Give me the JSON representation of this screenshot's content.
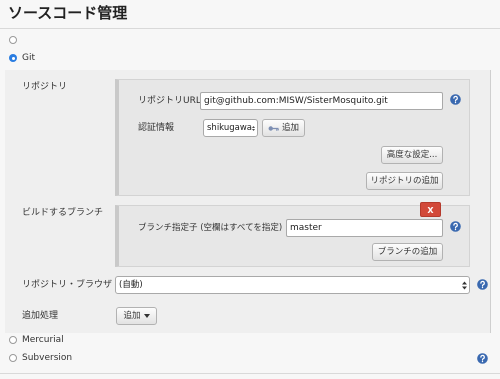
{
  "section_title": "ソースコード管理",
  "scm_options": {
    "git_label": "Git",
    "git_selected": true,
    "mercurial_label": "Mercurial",
    "subversion_label": "Subversion"
  },
  "git": {
    "repositories_label": "リポジトリ",
    "repository": {
      "url_label": "リポジトリURL",
      "url_value": "git@github.com:MISW/SisterMosquito.git",
      "credentials_label": "認証情報",
      "credentials_selected": "shikugawa",
      "add_credentials_label": "追加",
      "advanced_label": "高度な設定...",
      "add_repository_label": "リポジトリの追加"
    },
    "branches_label": "ビルドするブランチ",
    "branch": {
      "delete_label": "X",
      "specifier_label": "ブランチ指定子 (空欄はすべてを指定)",
      "specifier_value": "master",
      "add_branch_label": "ブランチの追加"
    },
    "browser_label": "リポジトリ・ブラウザ",
    "browser_selected": "(自動)",
    "additional_behaviours_label": "追加処理",
    "add_behaviour_label": "追加"
  },
  "icons": {
    "help": "help-icon",
    "key": "key-icon",
    "dropdown": "chevron-down-icon",
    "select_arrows": "select-arrows-icon"
  },
  "colors": {
    "radio_accent": "#2a7de1",
    "help_icon": "#3a69b0",
    "delete_button": "#d24939",
    "panel_background": "#efefef"
  }
}
